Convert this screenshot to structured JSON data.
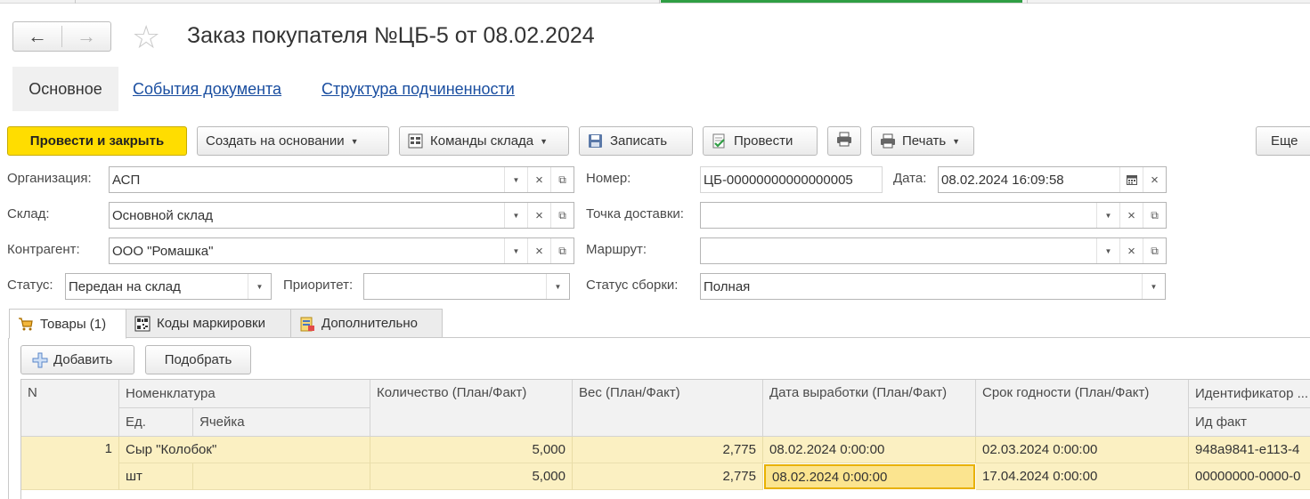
{
  "window": {
    "title": "Заказ покупателя №ЦБ-5 от 08.02.2024"
  },
  "sections": {
    "main": "Основное",
    "events": "События документа",
    "structure": "Структура подчиненности"
  },
  "toolbar": {
    "post_close": "Провести и закрыть",
    "create_based": "Создать на основании",
    "warehouse_cmds": "Команды склада",
    "save": "Записать",
    "post": "Провести",
    "print": "Печать",
    "more": "Еще"
  },
  "form": {
    "org_label": "Организация:",
    "org_value": "АСП",
    "number_label": "Номер:",
    "number_value": "ЦБ-00000000000000005",
    "date_label": "Дата:",
    "date_value": "08.02.2024 16:09:58",
    "warehouse_label": "Склад:",
    "warehouse_value": "Основной склад",
    "delivery_label": "Точка доставки:",
    "delivery_value": "",
    "contractor_label": "Контрагент:",
    "contractor_value": "ООО \"Ромашка\"",
    "route_label": "Маршрут:",
    "route_value": "",
    "status_label": "Статус:",
    "status_value": "Передан на склад",
    "priority_label": "Приоритет:",
    "priority_value": "",
    "assembly_label": "Статус сборки:",
    "assembly_value": "Полная"
  },
  "tabs": {
    "goods": "Товары (1)",
    "codes": "Коды маркировки",
    "extra": "Дополнительно"
  },
  "table_toolbar": {
    "add": "Добавить",
    "pick": "Подобрать"
  },
  "table": {
    "headers": {
      "n": "N",
      "nomenclature": "Номенклатура",
      "unit": "Ед.",
      "cell": "Ячейка",
      "quantity": "Количество (План/Факт)",
      "weight": "Вес (План/Факт)",
      "produced": "Дата выработки (План/Факт)",
      "expiry": "Срок годности (План/Факт)",
      "identifier": "Идентификатор ...",
      "id_fact": "Ид факт"
    },
    "rows": [
      {
        "n": "1",
        "nomenclature": "Сыр \"Колобок\"",
        "unit": "шт",
        "cell": "",
        "qty_plan": "5,000",
        "qty_fact": "5,000",
        "weight_plan": "2,775",
        "weight_fact": "2,775",
        "produced_plan": "08.02.2024 0:00:00",
        "produced_fact": "08.02.2024 0:00:00",
        "expiry_plan": "02.03.2024 0:00:00",
        "expiry_fact": "17.04.2024 0:00:00",
        "id_plan": "948a9841-e113-4",
        "id_fact": "00000000-0000-0"
      }
    ]
  },
  "colors": {
    "accent_button": "#ffdd00",
    "row_highlight": "#fbf0c2",
    "link": "#1a4ea0",
    "top_green": "#2f9e44"
  }
}
